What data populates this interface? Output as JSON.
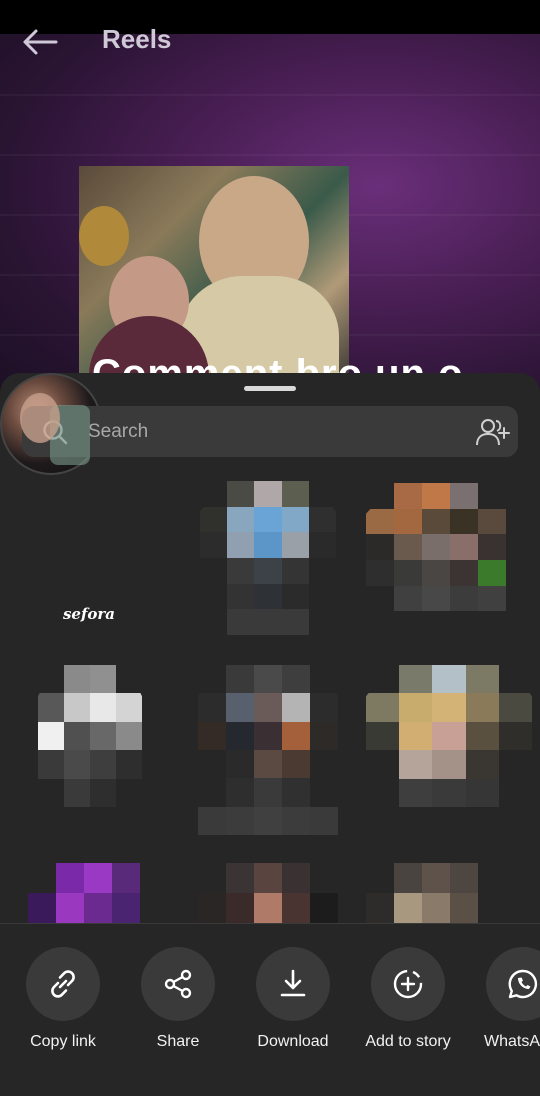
{
  "header": {
    "title": "Reels",
    "caption_overlay": "Comment bro un o"
  },
  "share_sheet": {
    "search": {
      "placeholder": "Search",
      "value": ""
    },
    "contacts": [
      {
        "name": "sefora"
      },
      {
        "name": ""
      },
      {
        "name": ""
      },
      {
        "name": ""
      },
      {
        "name": ""
      },
      {
        "name": ""
      },
      {
        "name": ""
      },
      {
        "name": ""
      },
      {
        "name": ""
      }
    ],
    "actions": [
      {
        "label": "Copy link",
        "icon": "link-icon"
      },
      {
        "label": "Share",
        "icon": "share-icon"
      },
      {
        "label": "Download",
        "icon": "download-icon"
      },
      {
        "label": "Add to story",
        "icon": "add-to-story-icon"
      },
      {
        "label": "WhatsA",
        "icon": "whatsapp-icon"
      }
    ]
  },
  "colors": {
    "sheet_bg": "#262626",
    "search_bg": "#3a3a3a",
    "action_circle_bg": "#3a3a3a",
    "text_primary": "#ffffff",
    "text_secondary": "#a8a8a8"
  }
}
